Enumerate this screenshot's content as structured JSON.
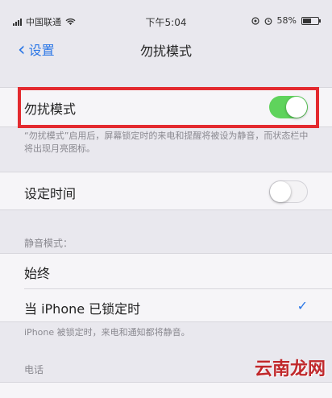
{
  "status_bar": {
    "carrier": "中国联通",
    "time": "下午5:04",
    "battery": "58%",
    "battery_level": 0.58
  },
  "nav": {
    "back_label": "设置",
    "title": "勿扰模式"
  },
  "dnd": {
    "label": "勿扰模式",
    "enabled": true,
    "footnote": "“勿扰模式”启用后，屏幕锁定时的来电和提醒将被设为静音，而状态栏中将出现月亮图标。"
  },
  "schedule": {
    "label": "设定时间",
    "enabled": false
  },
  "silence": {
    "header": "静音模式：",
    "options": [
      {
        "label": "始终",
        "selected": false
      },
      {
        "label": "当 iPhone 已锁定时",
        "selected": true
      }
    ],
    "footnote": "iPhone 被锁定时，来电和通知都将静音。"
  },
  "phone_header": "电话",
  "watermark": "云南龙网",
  "colors": {
    "accent": "#2a76e6",
    "toggle_on": "#5fd35c",
    "highlight": "#e32a2f"
  }
}
